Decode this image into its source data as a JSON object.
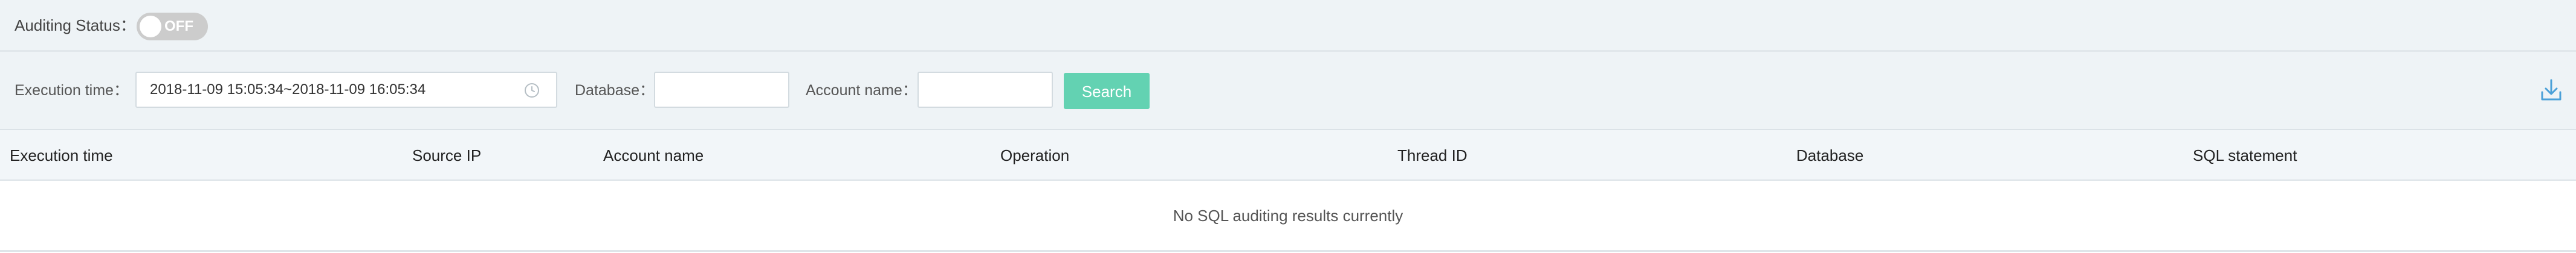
{
  "status": {
    "label": "Auditing Status：",
    "toggle_text": "OFF"
  },
  "filters": {
    "execution_time_label": "Execution time：",
    "execution_time_value": "2018-11-09 15:05:34~2018-11-09 16:05:34",
    "database_label": "Database：",
    "database_value": "",
    "account_name_label": "Account name：",
    "account_name_value": "",
    "search_label": "Search"
  },
  "icons": {
    "clock": "clock-icon",
    "download": "download-icon"
  },
  "colors": {
    "accent": "#63d2b2",
    "download_icon": "#4aa0d8",
    "toggle_off": "#cccccc",
    "panel_bg": "#eef3f6"
  },
  "table": {
    "columns": [
      "Execution time",
      "Source IP",
      "Account name",
      "Operation",
      "Thread ID",
      "Database",
      "SQL statement"
    ],
    "empty_message": "No SQL auditing results currently"
  }
}
